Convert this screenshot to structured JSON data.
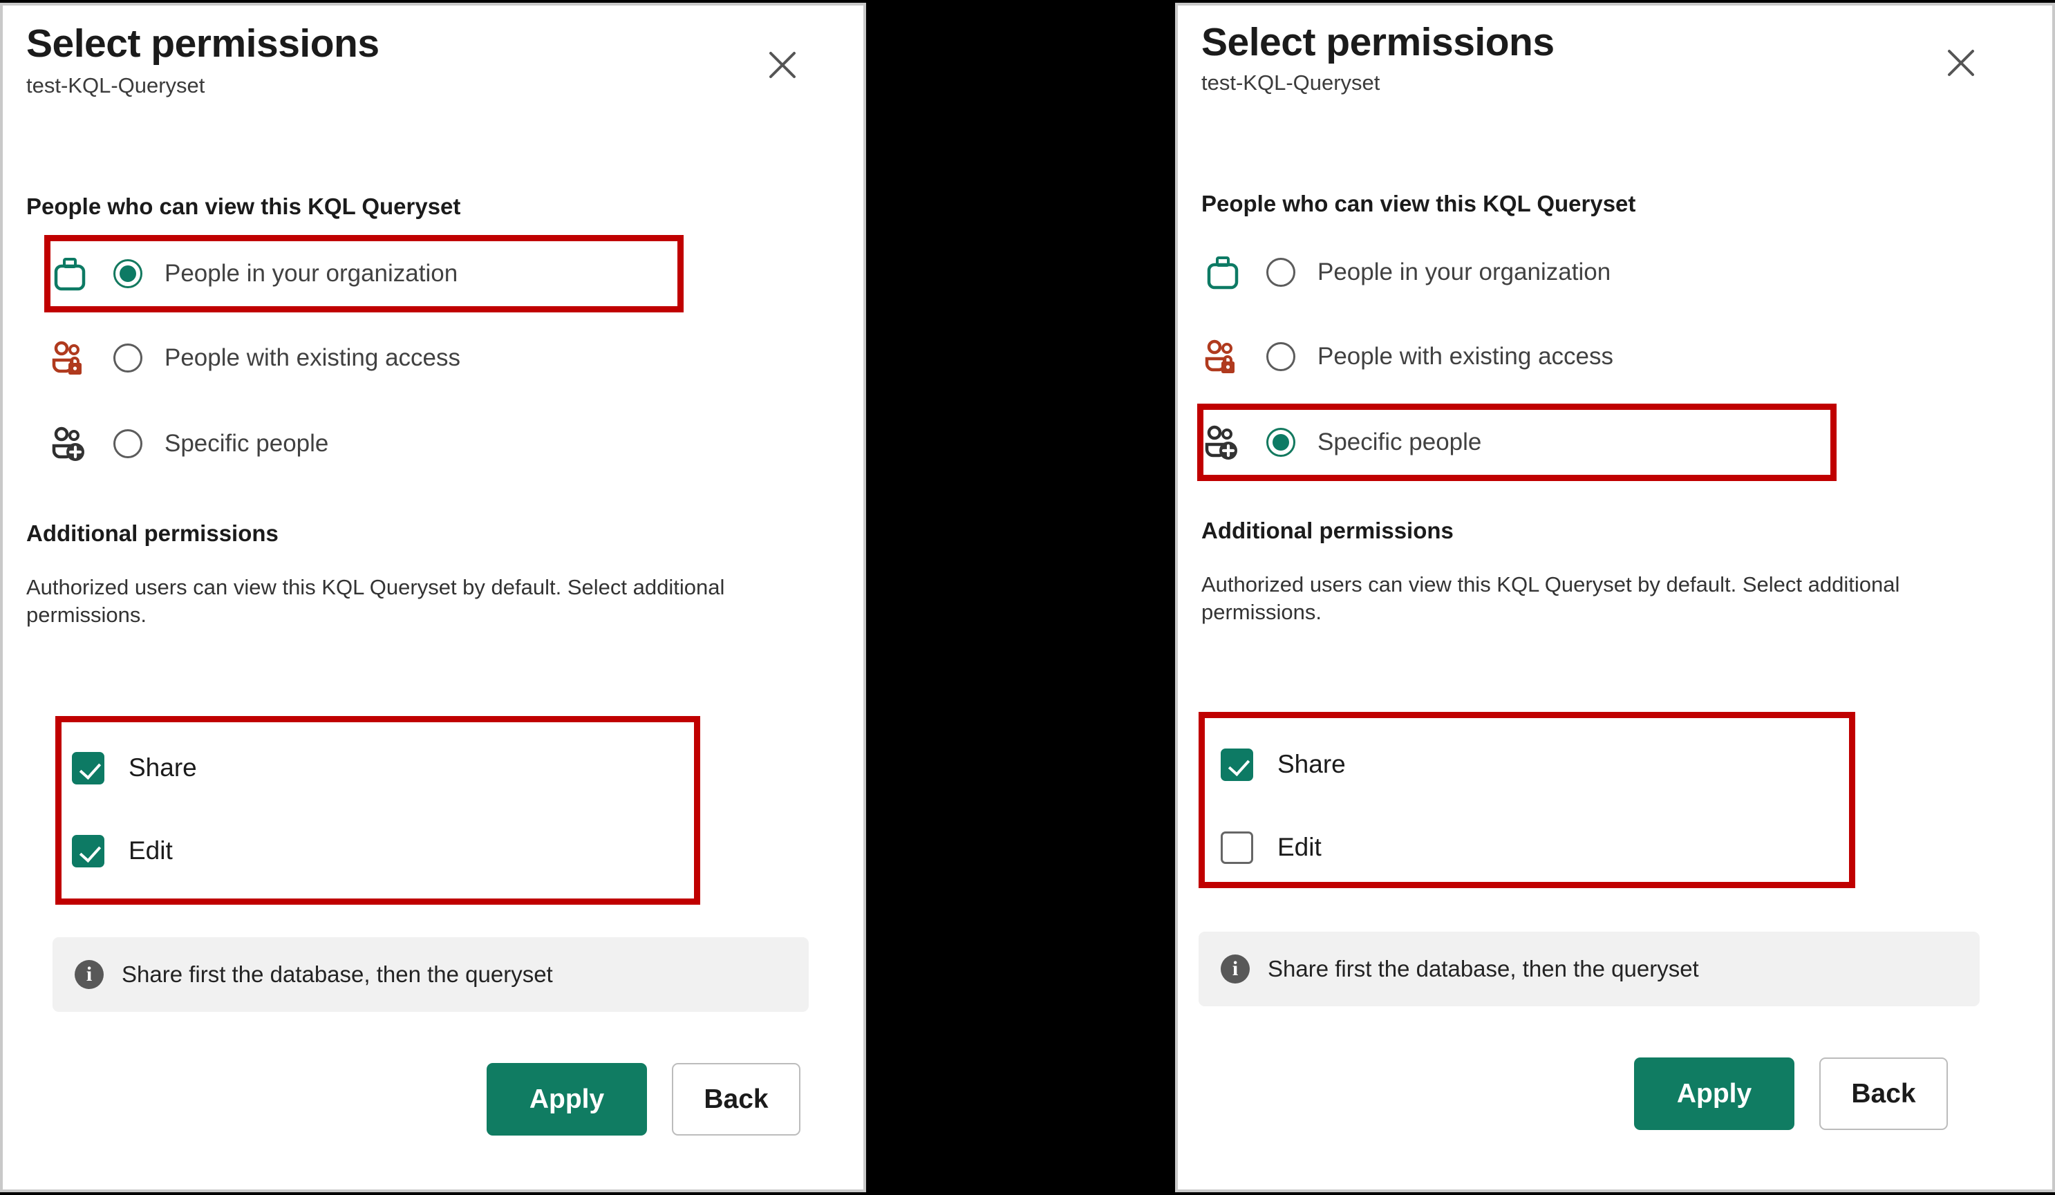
{
  "dialog": {
    "title": "Select permissions",
    "subtitle": "test-KQL-Queryset",
    "close_icon": "close-icon",
    "viewers_section_title": "People who can view this KQL Queryset",
    "additional_section_title": "Additional permissions",
    "additional_description": "Authorized users can view this KQL Queryset by default. Select additional permissions.",
    "info_message": "Share first the database, then the queryset",
    "info_icon": "info-icon",
    "apply_label": "Apply",
    "back_label": "Back"
  },
  "audience_options": [
    {
      "label": "People in your organization",
      "icon": "briefcase-icon"
    },
    {
      "label": "People with existing access",
      "icon": "people-lock-icon"
    },
    {
      "label": "Specific people",
      "icon": "people-add-icon"
    }
  ],
  "permission_options": [
    {
      "label": "Share"
    },
    {
      "label": "Edit"
    }
  ],
  "left_panel": {
    "selected_audience": "People in your organization",
    "selected_audience_index": 0,
    "share_checked": "checked",
    "edit_checked": "checked",
    "highlights": [
      "audience-option-0",
      "additional-permissions-group"
    ]
  },
  "right_panel": {
    "selected_audience": "Specific people",
    "selected_audience_index": 2,
    "share_checked": "checked",
    "edit_checked": "unchecked",
    "highlights": [
      "audience-option-2",
      "additional-permissions-group"
    ]
  },
  "colors": {
    "brand_green": "#107c62",
    "radio_green": "#0d7a64",
    "highlight_red": "#c00000",
    "people_lock_orange": "#b03a1e",
    "people_add_dark": "#343434",
    "panel_border_gray": "#c9c9c9",
    "info_bar_gray": "#f1f1f1",
    "backdrop_black": "#000000"
  }
}
